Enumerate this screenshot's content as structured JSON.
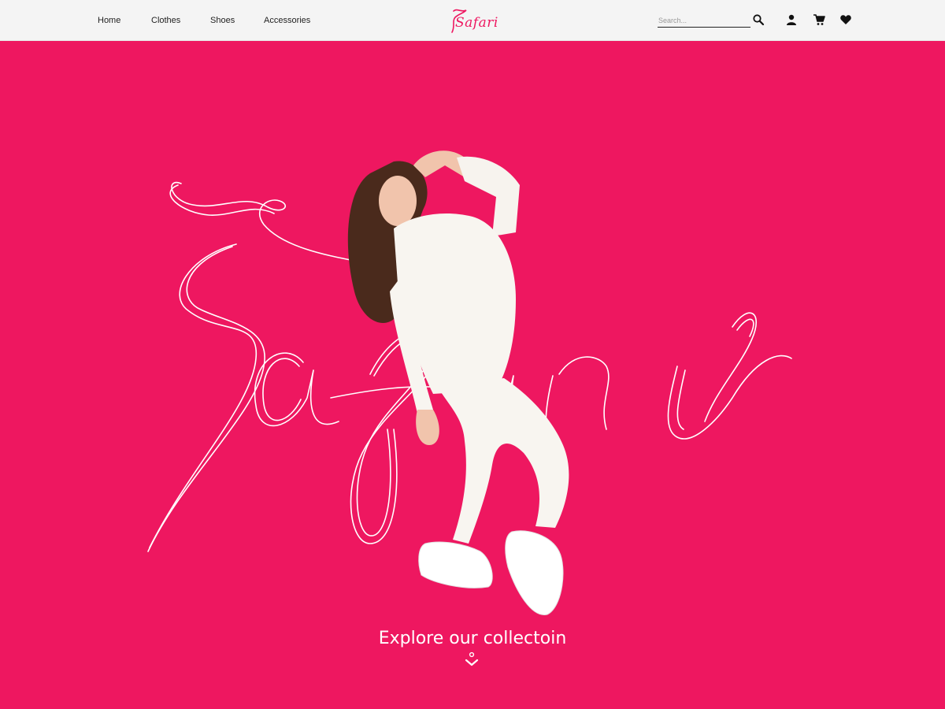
{
  "header": {
    "nav": [
      {
        "label": "Home"
      },
      {
        "label": "Clothes"
      },
      {
        "label": "Shoes"
      },
      {
        "label": "Accessories"
      }
    ],
    "logo_text": "Safari",
    "search_placeholder": "Search...",
    "icons": [
      "search-icon",
      "user-icon",
      "cart-icon",
      "heart-icon"
    ]
  },
  "hero": {
    "script_logo": "Safari",
    "cta_label": "Explore our collectoin",
    "cta_icon": "chevron-down-icon"
  },
  "colors": {
    "brand": "#ee1760",
    "header_bg": "#f4f4f4",
    "text_dark": "#222222",
    "text_light": "#ffffff"
  }
}
